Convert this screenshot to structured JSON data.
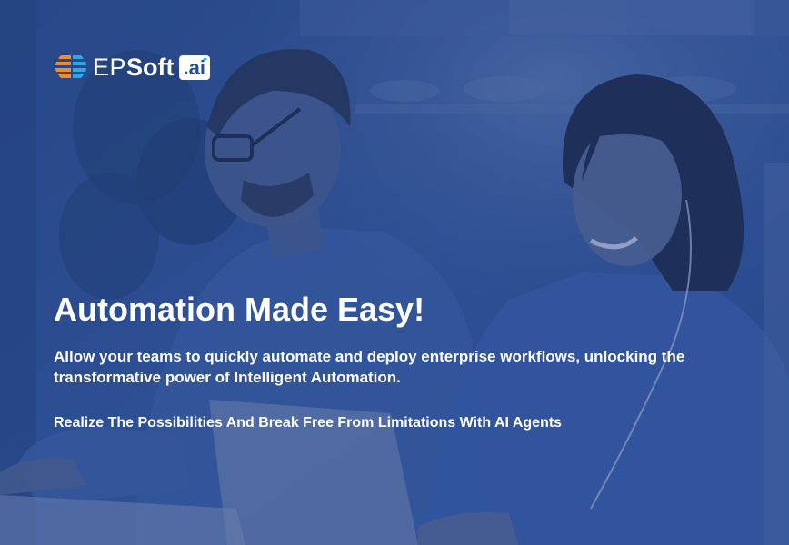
{
  "brand": {
    "name_prefix": "EP",
    "name_main": "Soft",
    "name_suffix": ".ai",
    "colors": {
      "logo_orange": "#f28c28",
      "logo_blue": "#2ea8e6",
      "overlay": "#2b4a86",
      "text": "#ffffff"
    }
  },
  "hero": {
    "headline": "Automation Made Easy!",
    "description": "Allow your teams to quickly automate and deploy enterprise workflows, unlocking the transformative power of Intelligent Automation.",
    "tagline": "Realize The Possibilities And Break Free From Limitations With AI Agents"
  }
}
